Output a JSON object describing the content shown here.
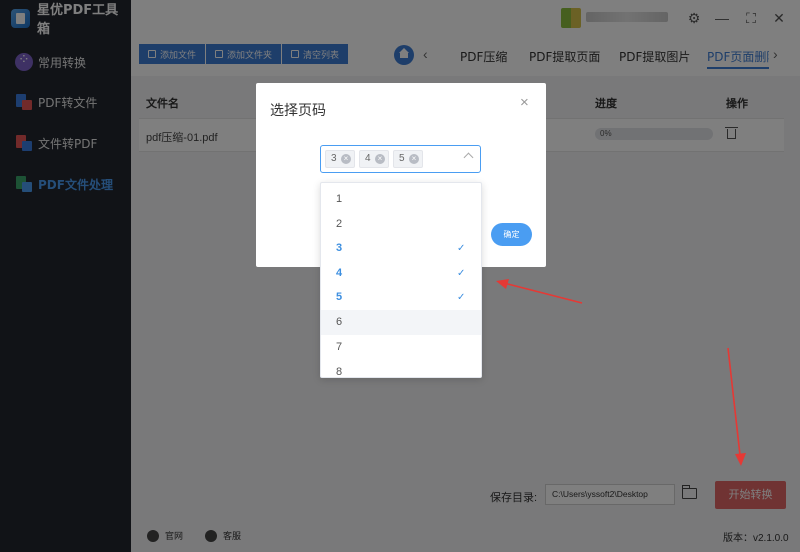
{
  "app": {
    "title": "星优PDF工具箱"
  },
  "sidebar": {
    "items": [
      {
        "label": "常用转换"
      },
      {
        "label": "PDF转文件"
      },
      {
        "label": "文件转PDF"
      },
      {
        "label": "PDF文件处理"
      }
    ]
  },
  "toolbar": {
    "add_file": "添加文件",
    "add_folder": "添加文件夹",
    "clear_list": "清空列表"
  },
  "tabs": [
    "PDF压缩",
    "PDF提取页面",
    "PDF提取图片",
    "PDF页面删除"
  ],
  "table": {
    "columns": {
      "filename": "文件名",
      "progress": "进度",
      "action": "操作"
    },
    "rows": [
      {
        "filename": "pdf压缩-01.pdf",
        "progress": "0%"
      }
    ]
  },
  "bottom": {
    "save_label": "保存目录:",
    "save_path": "C:\\Users\\yssoft2\\Desktop",
    "start_button": "开始转换",
    "link_website": "官网",
    "link_service": "客服",
    "version": "版本：v2.1.0.0"
  },
  "modal": {
    "title": "选择页码",
    "close": "×",
    "selected_tags": [
      "3",
      "4",
      "5"
    ],
    "confirm": "确定"
  },
  "dropdown": {
    "options": [
      {
        "label": "1",
        "selected": false
      },
      {
        "label": "2",
        "selected": false
      },
      {
        "label": "3",
        "selected": true
      },
      {
        "label": "4",
        "selected": true
      },
      {
        "label": "5",
        "selected": true
      },
      {
        "label": "6",
        "selected": false
      },
      {
        "label": "7",
        "selected": false
      },
      {
        "label": "8",
        "selected": false
      }
    ]
  },
  "colors": {
    "accent": "#3d7cd4",
    "sidebar_bg": "#22262e",
    "start_button": "#e06666",
    "annotation_arrow": "#e53935"
  }
}
